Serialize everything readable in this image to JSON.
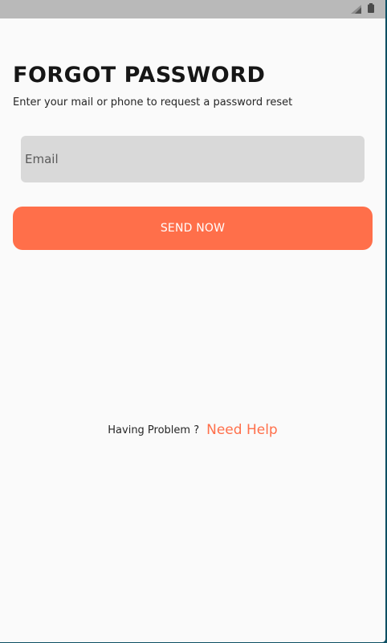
{
  "status_bar": {
    "icons": [
      "signal-icon",
      "battery-icon"
    ]
  },
  "page": {
    "title": "FORGOT PASSWORD",
    "subtitle": "Enter your mail or phone to request a password reset"
  },
  "form": {
    "email_placeholder": "Email",
    "email_value": "",
    "send_label": "SEND NOW"
  },
  "help": {
    "question": "Having Problem ?",
    "link_label": "Need Help"
  },
  "colors": {
    "accent": "#ff6f4a",
    "input_background": "#d9d9d9",
    "page_background": "#fafafa",
    "status_bar": "#b9b9b9",
    "title_text": "#161616"
  }
}
